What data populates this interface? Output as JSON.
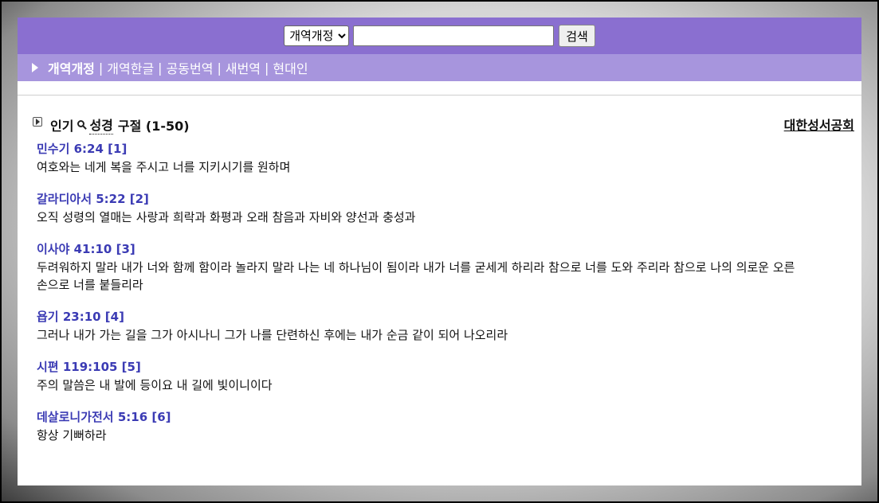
{
  "search": {
    "selected_version": "개역개정",
    "input_value": "",
    "button_label": "검색"
  },
  "tabs": [
    {
      "label": "개역개정",
      "active": true
    },
    {
      "label": "개역한글",
      "active": false
    },
    {
      "label": "공동번역",
      "active": false
    },
    {
      "label": "새번역",
      "active": false
    },
    {
      "label": "현대인",
      "active": false
    }
  ],
  "tab_separator": "|",
  "section": {
    "title_prefix": "인기",
    "title_word": "성경",
    "title_suffix": "구절 (1-50)",
    "publisher": "대한성서공회"
  },
  "verses": [
    {
      "ref": "민수기 6:24 [1]",
      "text": "여호와는 네게 복을 주시고 너를 지키시기를 원하며"
    },
    {
      "ref": "갈라디아서 5:22 [2]",
      "text": "오직 성령의 열매는 사랑과 희락과 화평과 오래 참음과 자비와 양선과 충성과"
    },
    {
      "ref": "이사야 41:10 [3]",
      "text": "두려워하지 말라 내가 너와 함께 함이라 놀라지 말라 나는 네 하나님이 됨이라 내가 너를 굳세게 하리라 참으로 너를 도와 주리라 참으로 나의 의로운 오른손으로 너를 붙들리라"
    },
    {
      "ref": "욥기 23:10 [4]",
      "text": "그러나 내가 가는 길을 그가 아시나니 그가 나를 단련하신 후에는 내가 순금 같이 되어 나오리라"
    },
    {
      "ref": "시편 119:105 [5]",
      "text": "주의 말씀은 내 발에 등이요 내 길에 빛이니이다"
    },
    {
      "ref": "데살로니가전서 5:16 [6]",
      "text": "항상 기뻐하라"
    }
  ]
}
